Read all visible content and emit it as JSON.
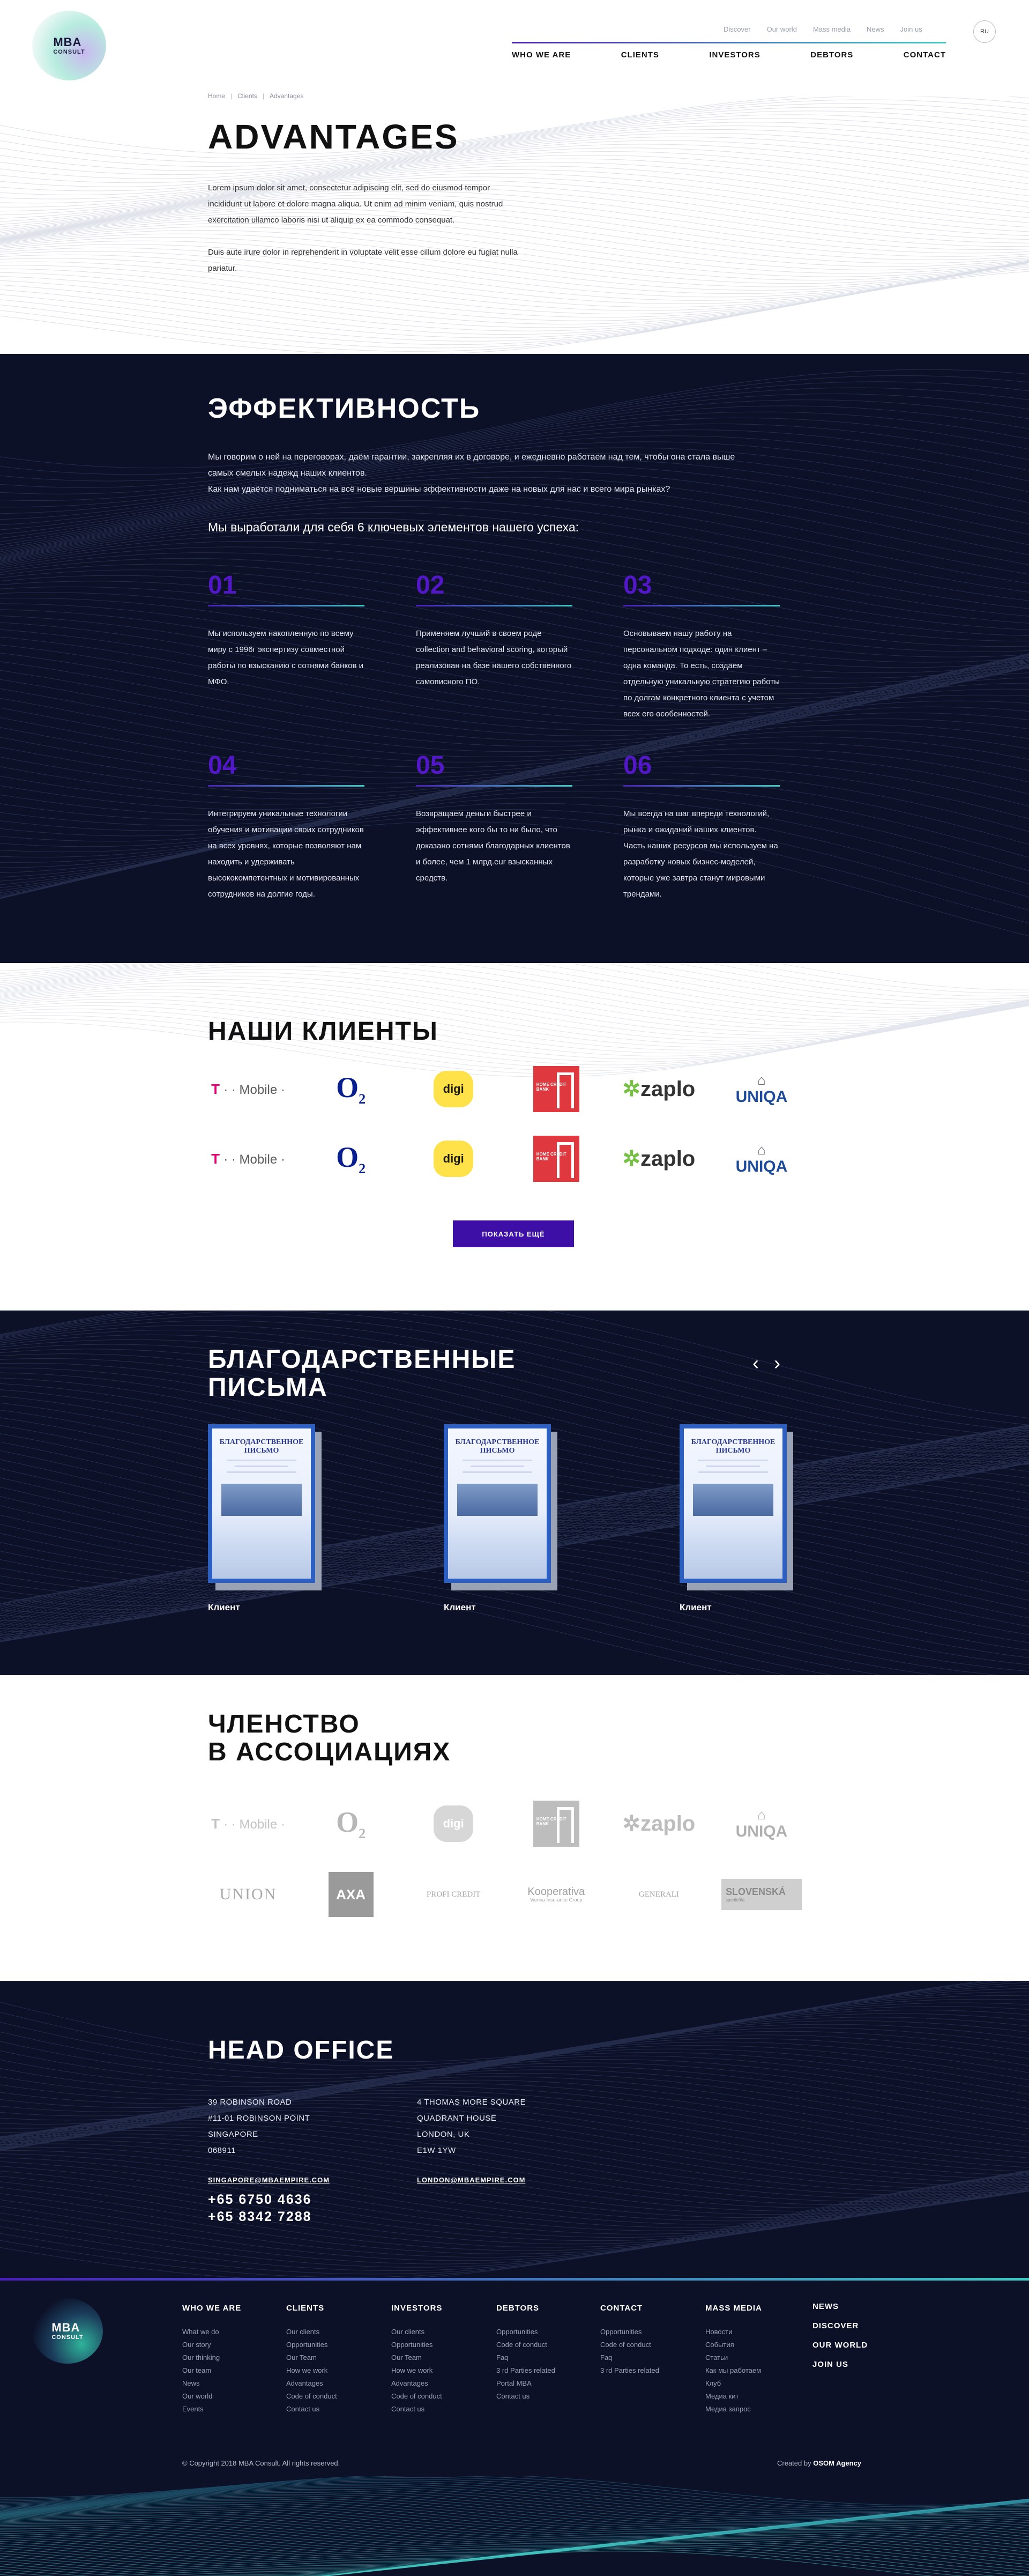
{
  "brand": {
    "logo_line1": "MBA",
    "logo_line2": "CONSULT"
  },
  "top_nav": [
    "Discover",
    "Our world",
    "Mass media",
    "News",
    "Join us"
  ],
  "lang": "RU",
  "main_nav": [
    "WHO WE ARE",
    "CLIENTS",
    "INVESTORS",
    "DEBTORS",
    "CONTACT"
  ],
  "breadcrumb": [
    "Home",
    "Clients",
    "Advantages"
  ],
  "page_title": "ADVANTAGES",
  "intro": [
    "Lorem ipsum dolor sit amet, consectetur adipiscing elit, sed do eiusmod tempor incididunt ut labore et dolore magna aliqua. Ut enim ad minim veniam, quis nostrud exercitation ullamco laboris nisi ut aliquip ex ea commodo consequat.",
    "Duis aute irure dolor in reprehenderit in voluptate velit esse cillum dolore eu fugiat nulla pariatur."
  ],
  "efficiency": {
    "title": "ЭФФЕКТИВНОСТЬ",
    "lead": "Мы говорим о ней на переговорах, даём гарантии, закрепляя их в договоре, и ежедневно работаем над тем, чтобы она стала выше самых смелых надежд наших клиентов.",
    "lead2": "Как нам удаётся подниматься на всё новые вершины эффективности даже на новых для нас и всего мира рынках?",
    "subtitle": "Мы выработали для себя 6 ключевых элементов нашего успеха:",
    "items": [
      {
        "num": "01",
        "text": "Мы используем накопленную по всему миру с 1996г экспертизу совместной работы по взысканию с сотнями банков и МФО."
      },
      {
        "num": "02",
        "text": "Применяем лучший в своем роде collection and behavioral scoring, который реализован на базе нашего собственного самописного ПО."
      },
      {
        "num": "03",
        "text": "Основываем нашу работу на персональном подходе: один клиент – одна команда. То есть, создаем отдельную уникальную стратегию работы по долгам конкретного клиента с учетом всех его особенностей."
      },
      {
        "num": "04",
        "text": "Интегрируем уникальные технологии обучения и мотивации своих сотрудников на всех уровнях, которые позволяют нам находить и удерживать высококомпетентных и мотивированных сотрудников на долгие годы."
      },
      {
        "num": "05",
        "text": "Возвращаем деньги быстрее и эффективнее кого бы то ни было, что доказано сотнями благодарных клиентов и более, чем 1 млрд.eur взысканных средств."
      },
      {
        "num": "06",
        "text": "Мы всегда на шаг впереди технологий, рынка и ожиданий наших клиентов. Часть наших ресурсов мы используем на разработку новых бизнес-моделей, которые уже завтра станут мировыми трендами."
      }
    ]
  },
  "clients": {
    "title": "НАШИ КЛИЕНТЫ",
    "logos": {
      "tmobile_t": "T",
      "tmobile_rest": "· · Mobile ·",
      "o2": "O",
      "o2_sub": "2",
      "digi": "digi",
      "homecredit": "HOME CREDIT BANK",
      "zaplo": "zaplo",
      "zaplo_mark": "✲",
      "uniqa_mark": "⌂",
      "uniqa": "UNIQA"
    },
    "button": "ПОКАЗАТЬ ЕЩЁ"
  },
  "letters": {
    "title_line1": "БЛАГОДАРСТВЕННЫЕ",
    "title_line2": "ПИСЬМА",
    "prev_icon": "chevron-left-icon",
    "next_icon": "chevron-right-icon",
    "doc_title": "БЛАГОДАРСТВЕННОЕ ПИСЬМО",
    "caption": "Клиент"
  },
  "membership": {
    "title_line1": "ЧЛЕНСТВО",
    "title_line2": "В АССОЦИАЦИЯХ",
    "union": "UNION",
    "axa": "AXA",
    "profi": "PROFI CREDIT",
    "koop": "Kooperativa",
    "koop_sub": "Vienna Insurance Group",
    "generali": "GENERALI",
    "slov": "SLOVENSKÁ",
    "slov_sub": "sporiteľňa"
  },
  "office": {
    "title": "HEAD OFFICE",
    "addr1": [
      "39 ROBINSON ROAD",
      "#11-01 ROBINSON POINT",
      "SINGAPORE",
      "068911"
    ],
    "addr2": [
      "4 THOMAS MORE SQUARE",
      "QUADRANT HOUSE",
      "LONDON, UK",
      "E1W 1YW"
    ],
    "email1": "SINGAPORE@MBAEMPIRE.COM",
    "email2": "LONDON@MBAEMPIRE.COM",
    "phone1": "+65 6750 4636",
    "phone2": "+65 8342 7288"
  },
  "footer": {
    "columns": [
      {
        "title": "WHO WE ARE",
        "links": [
          "What we do",
          "Our story",
          "Our thinking",
          "Our team",
          "News",
          "Our world",
          "Events"
        ]
      },
      {
        "title": "CLIENTS",
        "links": [
          "Our clients",
          "Opportunities",
          "Our Team",
          "How we work",
          "Advantages",
          "Code of conduct",
          "Contact us"
        ]
      },
      {
        "title": "INVESTORS",
        "links": [
          "Our clients",
          "Opportunities",
          "Our Team",
          "How we work",
          "Advantages",
          "Code of conduct",
          "Contact us"
        ]
      },
      {
        "title": "DEBTORS",
        "links": [
          "Opportunities",
          "Code of conduct",
          "Faq",
          "3 rd Parties related",
          "Portal MBA",
          "Contact us"
        ]
      },
      {
        "title": "CONTACT",
        "links": [
          "Opportunities",
          "Code of conduct",
          "Faq",
          "3 rd Parties related"
        ]
      },
      {
        "title": "MASS MEDIA",
        "links": [
          "Новости",
          "События",
          "Статьи",
          "Как мы работаем",
          "Клуб",
          "Медиа кит",
          "Медиа запрос"
        ]
      }
    ],
    "mini_links": [
      "NEWS",
      "DISCOVER",
      "OUR WORLD",
      "JOIN US"
    ],
    "copyright": "© Copyright 2018 MBA Consult. All rights reserved.",
    "credit_prefix": "Created by",
    "credit_name": "OSOM Agency"
  },
  "colors": {
    "dark_bg": "#0c1128",
    "accent": "#5217c7",
    "teal": "#3fc9c3",
    "button": "#3e0fa6"
  }
}
